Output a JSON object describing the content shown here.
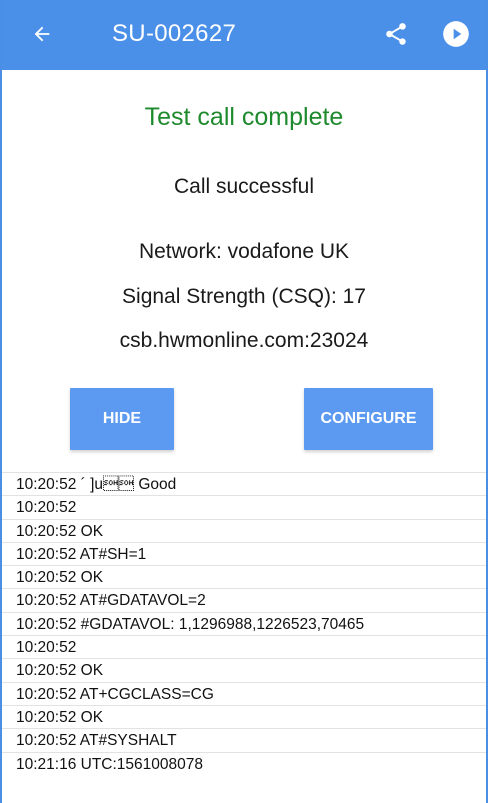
{
  "appbar": {
    "title": "SU-002627",
    "back_icon": "arrow-left-icon",
    "share_icon": "share-icon",
    "play_icon": "play-circle-icon",
    "color": "#4a90e8"
  },
  "status": {
    "title": "Test call complete",
    "title_color": "#1e8a2e",
    "result": "Call successful",
    "network": "Network: vodafone UK",
    "signal": "Signal Strength (CSQ): 17",
    "server": "csb.hwmonline.com:23024"
  },
  "buttons": {
    "hide": "HIDE",
    "configure": "CONFIGURE",
    "color": "#5b9af0"
  },
  "log": [
    "10:20:52 ´ ]u\u0001\u0001 Good",
    "10:20:52",
    "10:20:52 OK",
    "10:20:52 AT#SH=1",
    "10:20:52 OK",
    "10:20:52 AT#GDATAVOL=2",
    "10:20:52 #GDATAVOL: 1,1296988,1226523,70465",
    "10:20:52",
    "10:20:52 OK",
    "10:20:52 AT+CGCLASS=CG",
    "10:20:52 OK",
    "10:20:52 AT#SYSHALT",
    "10:21:16 UTC:1561008078"
  ]
}
